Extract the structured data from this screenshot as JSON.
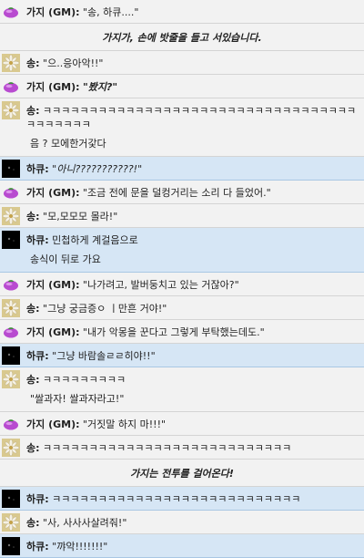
{
  "messages": [
    {
      "kind": "msg",
      "av": "gaji",
      "hl": false,
      "name": "가지 (GM):",
      "text": "\"송, 하큐....\"",
      "style": "",
      "extra": ""
    },
    {
      "kind": "narr",
      "text": "가지가, 손에 밧줄을 들고 서있습니다."
    },
    {
      "kind": "msg",
      "av": "song",
      "hl": false,
      "name": "송:",
      "text": "\"으..응아악!!\"",
      "style": "",
      "extra": ""
    },
    {
      "kind": "msg",
      "av": "gaji",
      "hl": false,
      "name": "가지 (GM):",
      "text": "\"봤지?\"",
      "style": "bolditalic",
      "extra": ""
    },
    {
      "kind": "msg",
      "av": "song",
      "hl": false,
      "name": "송:",
      "text": "ㅋㅋㅋㅋㅋㅋㅋㅋㅋㅋㅋㅋㅋㅋㅋㅋㅋㅋㅋㅋㅋㅋㅋㅋㅋㅋㅋㅋㅋㅋㅋㅋㅋㅋㅋㅋㅋㅋㅋㅋㅋ",
      "style": "",
      "extra": "음 ? 모에한거갗다"
    },
    {
      "kind": "msg",
      "av": "hakyu",
      "hl": true,
      "name": "하큐:",
      "text": "\"아니???????????!\"",
      "style": "italic",
      "extra": ""
    },
    {
      "kind": "msg",
      "av": "gaji",
      "hl": false,
      "name": "가지 (GM):",
      "text": "\"조금 전에 문을 덜컹거리는 소리 다 들었어.\"",
      "style": "",
      "extra": ""
    },
    {
      "kind": "msg",
      "av": "song",
      "hl": false,
      "name": "송:",
      "text": "\"모,모모모 몰라!\"",
      "style": "",
      "extra": ""
    },
    {
      "kind": "msg",
      "av": "hakyu",
      "hl": true,
      "name": "하큐:",
      "text": "민첩하게 계걸음으로",
      "style": "",
      "extra": "송식이 뒤로 가요"
    },
    {
      "kind": "msg",
      "av": "gaji",
      "hl": false,
      "name": "가지 (GM):",
      "text": "\"나가려고, 발버둥치고 있는 거잖아?\"",
      "style": "",
      "extra": ""
    },
    {
      "kind": "msg",
      "av": "song",
      "hl": false,
      "name": "송:",
      "text": "\"그냥 궁금증ㅇ ㅣ만흔 거야!\"",
      "style": "",
      "extra": ""
    },
    {
      "kind": "msg",
      "av": "gaji",
      "hl": false,
      "name": "가지 (GM):",
      "text": "\"내가 악몽을 꾼다고 그렇게 부탁했는데도.\"",
      "style": "",
      "extra": ""
    },
    {
      "kind": "msg",
      "av": "hakyu",
      "hl": true,
      "name": "하큐:",
      "text": "\"그냥 바람솔ㄹㄹ히야!!\"",
      "style": "",
      "extra": ""
    },
    {
      "kind": "msg",
      "av": "song",
      "hl": false,
      "name": "송:",
      "text": "ㅋㅋㅋㅋㅋㅋㅋㅋㅋ",
      "style": "",
      "extra": "\"쌀과자! 쌀과자라고!\""
    },
    {
      "kind": "msg",
      "av": "gaji",
      "hl": false,
      "name": "가지 (GM):",
      "text": "\"거짓말 하지 마!!!\"",
      "style": "",
      "extra": ""
    },
    {
      "kind": "msg",
      "av": "song",
      "hl": false,
      "name": "송:",
      "text": "ㅋㅋㅋㅋㅋㅋㅋㅋㅋㅋㅋㅋㅋㅋㅋㅋㅋㅋㅋㅋㅋㅋㅋㅋㅋㅋㅋ",
      "style": "",
      "extra": ""
    },
    {
      "kind": "narr",
      "text": "가지는 전투를 걸어온다!"
    },
    {
      "kind": "msg",
      "av": "hakyu",
      "hl": true,
      "name": "하큐:",
      "text": "ㅋㅋㅋㅋㅋㅋㅋㅋㅋㅋㅋㅋㅋㅋㅋㅋㅋㅋㅋㅋㅋㅋㅋㅋㅋㅋㅋ",
      "style": "",
      "extra": ""
    },
    {
      "kind": "msg",
      "av": "song",
      "hl": false,
      "name": "송:",
      "text": "\"사, 사사사살려줘!\"",
      "style": "",
      "extra": ""
    },
    {
      "kind": "msg",
      "av": "hakyu",
      "hl": true,
      "name": "하큐:",
      "text": "\"꺄악!!!!!!!\"",
      "style": "",
      "extra": ""
    }
  ],
  "colors": {
    "highlight_bg": "#d6e6f5",
    "eggplant": "#b84bd0",
    "avatar_song": "#d9c98f",
    "avatar_hakyu": "#000000"
  },
  "icons": {
    "gaji": "eggplant-avatar-icon",
    "song": "flower-avatar-icon",
    "hakyu": "dark-avatar-icon"
  }
}
